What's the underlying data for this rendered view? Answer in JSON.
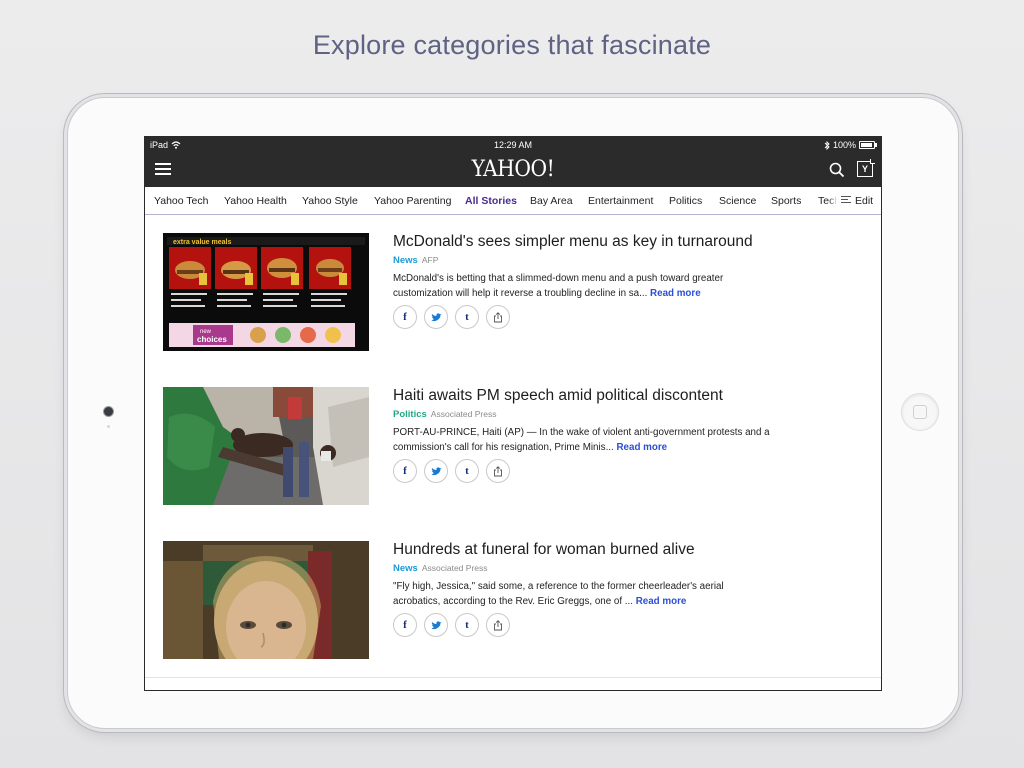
{
  "tagline": "Explore categories that fascinate",
  "statusbar": {
    "device": "iPad",
    "time": "12:29 AM",
    "battery": "100%"
  },
  "navbar": {
    "logo": "YAHOO!"
  },
  "tabs": [
    {
      "label": "Yahoo Tech",
      "active": false
    },
    {
      "label": "Yahoo Health",
      "active": false
    },
    {
      "label": "Yahoo Style",
      "active": false
    },
    {
      "label": "Yahoo Parenting",
      "active": false
    },
    {
      "label": "All Stories",
      "active": true
    },
    {
      "label": "Bay Area",
      "active": false
    },
    {
      "label": "Entertainment",
      "active": false
    },
    {
      "label": "Politics",
      "active": false
    },
    {
      "label": "Science",
      "active": false
    },
    {
      "label": "Sports",
      "active": false
    },
    {
      "label": "Tech",
      "active": false
    }
  ],
  "edit_label": "Edit",
  "stories": [
    {
      "title": "McDonald's sees simpler menu as key in turnaround",
      "category": "News",
      "source": "AFP",
      "summary": "McDonald's is betting that a slimmed-down menu and a push toward greater customization will help it reverse a troubling decline in sa...",
      "read_more": "Read more"
    },
    {
      "title": "Haiti awaits PM speech amid political discontent",
      "category": "Politics",
      "source": "Associated Press",
      "summary": "PORT-AU-PRINCE, Haiti (AP) — In the wake of violent anti-government protests and a commission's call for his resignation, Prime Minis...",
      "read_more": "Read more"
    },
    {
      "title": "Hundreds at funeral for woman burned alive",
      "category": "News",
      "source": "Associated Press",
      "summary": "\"Fly high, Jessica,\" said some, a reference to the former cheerleader's aerial acrobatics, according to the Rev. Eric Greggs, one of ...",
      "read_more": "Read more"
    }
  ],
  "menu_board_text": {
    "header": "extra value meals",
    "banner_top": "new",
    "banner_bottom": "choices"
  },
  "share_icons": [
    "facebook-icon",
    "twitter-icon",
    "tumblr-icon",
    "share-icon"
  ],
  "colors": {
    "accent_active_tab": "#4a2a8c",
    "news": "#1e9ad6",
    "politics": "#22a886",
    "read_more": "#2b4fd6",
    "navbar": "#2b2b2b"
  }
}
